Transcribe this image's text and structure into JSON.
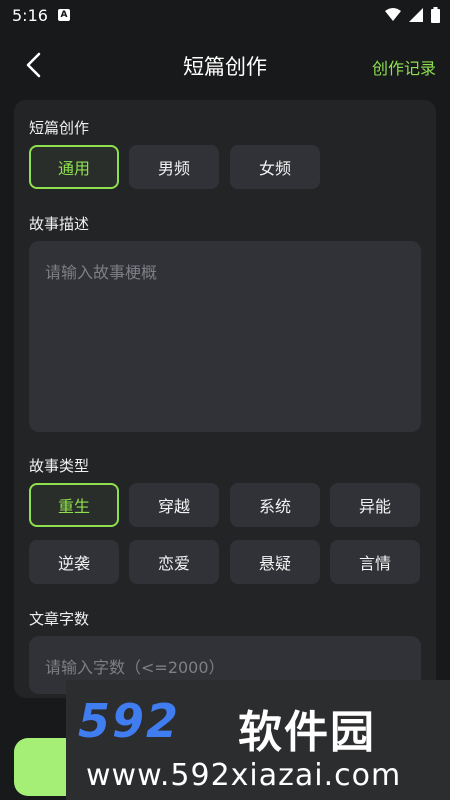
{
  "status_bar": {
    "time": "5:16",
    "notification_letter": "A"
  },
  "header": {
    "title": "短篇创作",
    "history_link": "创作记录"
  },
  "sections": {
    "category": {
      "label": "短篇创作",
      "options": [
        "通用",
        "男频",
        "女频"
      ],
      "selected": "通用"
    },
    "description": {
      "label": "故事描述",
      "placeholder": "请输入故事梗概"
    },
    "genre": {
      "label": "故事类型",
      "options": [
        "重生",
        "穿越",
        "系统",
        "异能",
        "逆袭",
        "恋爱",
        "悬疑",
        "言情"
      ],
      "selected": "重生"
    },
    "word_count": {
      "label": "文章字数",
      "placeholder": "请输入字数（<=2000）"
    }
  },
  "watermark": {
    "logo": "592",
    "brand": "软件园",
    "url": "www.592xiazai.com"
  },
  "colors": {
    "accent": "#8ee04f",
    "background": "#18191b",
    "card": "#232426",
    "chip": "#303238",
    "logo_blue": "#3f7df0"
  }
}
